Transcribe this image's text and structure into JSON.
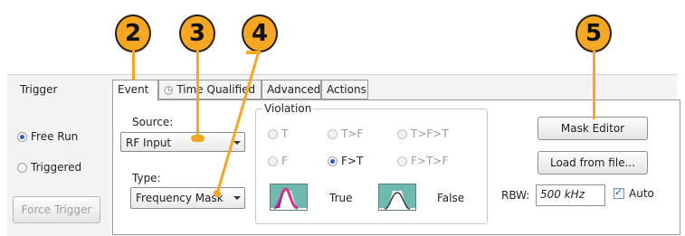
{
  "callouts": [
    "2",
    "3",
    "4",
    "5"
  ],
  "left": {
    "title": "Trigger",
    "free_run": "Free Run",
    "triggered": "Triggered",
    "force_trigger": "Force Trigger"
  },
  "tabs": [
    "Event",
    "Time Qualified",
    "Advanced",
    "Actions"
  ],
  "event": {
    "source_label": "Source:",
    "source_value": "RF Input",
    "type_label": "Type:",
    "type_value": "Frequency Mask"
  },
  "violation": {
    "label": "Violation",
    "options": [
      "T",
      "T>F",
      "T>F>T",
      "F",
      "F>T",
      "F>T>F"
    ],
    "selected": "F>T",
    "true_label": "True",
    "false_label": "False"
  },
  "right": {
    "mask_editor": "Mask Editor",
    "load_from_file": "Load from file...",
    "rbw_label": "RBW:",
    "rbw_value": "500 kHz",
    "auto_label": "Auto",
    "auto_checked": true
  },
  "colors": {
    "callout": "#f5a623",
    "mask": "#6fb9b0",
    "selected_radio": "#2b5fb3"
  }
}
